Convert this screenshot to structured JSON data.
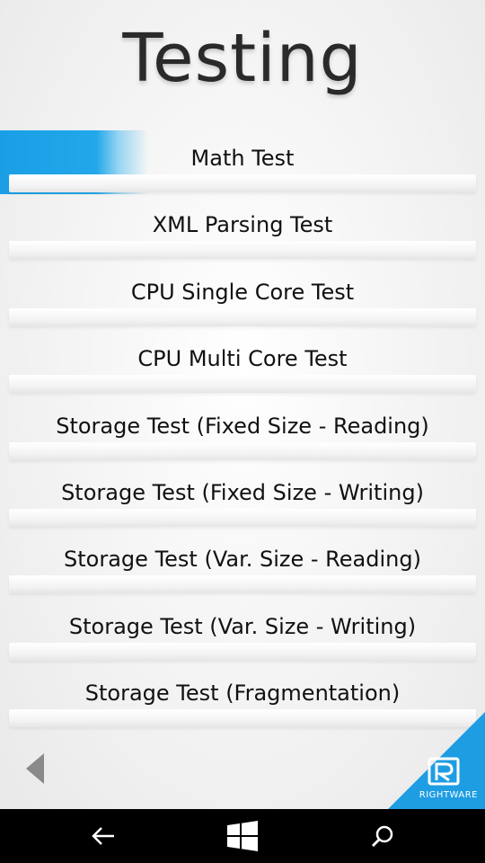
{
  "header": {
    "title": "Testing"
  },
  "tests": [
    {
      "label": "Math Test",
      "selected": true
    },
    {
      "label": "XML Parsing Test",
      "selected": false
    },
    {
      "label": "CPU Single Core Test",
      "selected": false
    },
    {
      "label": "CPU Multi Core Test",
      "selected": false
    },
    {
      "label": "Storage Test (Fixed Size - Reading)",
      "selected": false
    },
    {
      "label": "Storage Test (Fixed Size - Writing)",
      "selected": false
    },
    {
      "label": "Storage Test (Var. Size - Reading)",
      "selected": false
    },
    {
      "label": "Storage Test (Var. Size - Writing)",
      "selected": false
    },
    {
      "label": "Storage Test (Fragmentation)",
      "selected": false
    }
  ],
  "footer": {
    "brand": "RIGHTWARE"
  },
  "colors": {
    "accent": "#1a9fe6",
    "text": "#111111",
    "navbar": "#000000"
  },
  "icons": {
    "back": "triangle-left-icon",
    "nav_back": "arrow-left-icon",
    "nav_home": "windows-logo-icon",
    "nav_search": "search-icon"
  }
}
